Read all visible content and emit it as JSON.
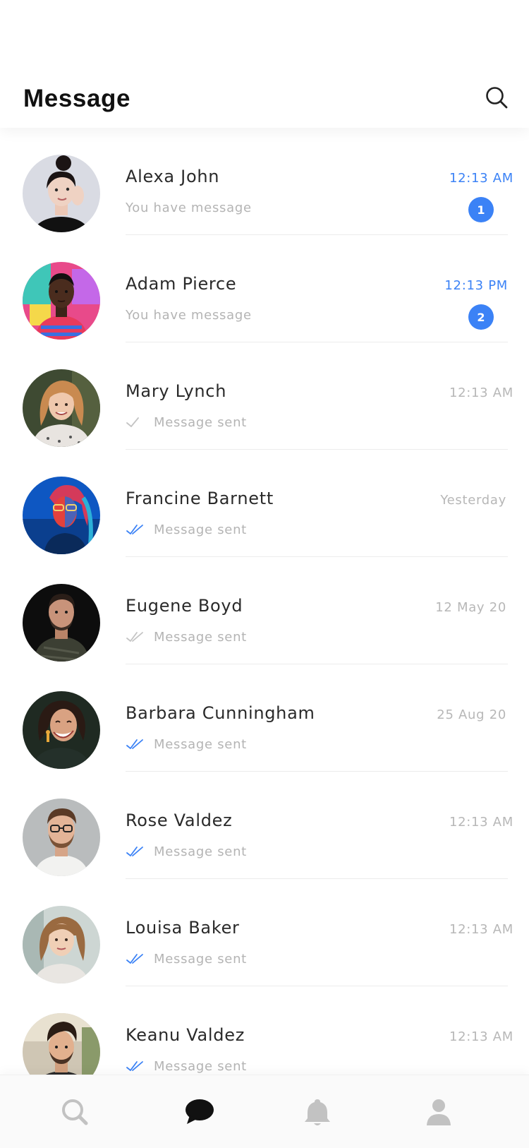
{
  "header": {
    "title": "Message",
    "search_icon": "search-icon"
  },
  "colors": {
    "accent": "#3b82f6",
    "muted_text": "#b4b4b4",
    "title_text": "#111111"
  },
  "conversations": [
    {
      "name": "Alexa John",
      "preview": "You have message",
      "time": "12:13 AM",
      "unread": true,
      "badge": "1",
      "status": "none",
      "avatar_icon": "avatar-photo"
    },
    {
      "name": "Adam Pierce",
      "preview": "You have message",
      "time": "12:13 PM",
      "unread": true,
      "badge": "2",
      "status": "none",
      "avatar_icon": "avatar-photo"
    },
    {
      "name": "Mary Lynch",
      "preview": "Message sent",
      "time": "12:13 AM",
      "unread": false,
      "badge": "",
      "status": "single-check-icon",
      "avatar_icon": "avatar-photo"
    },
    {
      "name": "Francine Barnett",
      "preview": "Message sent",
      "time": "Yesterday",
      "unread": false,
      "badge": "",
      "status": "double-check-read-icon",
      "avatar_icon": "avatar-photo"
    },
    {
      "name": "Eugene Boyd",
      "preview": "Message sent",
      "time": "12 May 20",
      "unread": false,
      "badge": "",
      "status": "double-check-icon",
      "avatar_icon": "avatar-photo"
    },
    {
      "name": "Barbara Cunningham",
      "preview": "Message sent",
      "time": "25 Aug 20",
      "unread": false,
      "badge": "",
      "status": "double-check-read-icon",
      "avatar_icon": "avatar-photo"
    },
    {
      "name": "Rose Valdez",
      "preview": "Message sent",
      "time": "12:13 AM",
      "unread": false,
      "badge": "",
      "status": "double-check-read-icon",
      "avatar_icon": "avatar-photo"
    },
    {
      "name": "Louisa Baker",
      "preview": "Message sent",
      "time": "12:13 AM",
      "unread": false,
      "badge": "",
      "status": "double-check-read-icon",
      "avatar_icon": "avatar-photo"
    },
    {
      "name": "Keanu Valdez",
      "preview": "Message sent",
      "time": "12:13 AM",
      "unread": false,
      "badge": "",
      "status": "double-check-read-icon",
      "avatar_icon": "avatar-photo"
    }
  ],
  "bottom_nav": {
    "items": [
      {
        "icon": "search-icon",
        "active": false
      },
      {
        "icon": "chat-bubble-icon",
        "active": true
      },
      {
        "icon": "bell-icon",
        "active": false
      },
      {
        "icon": "user-icon",
        "active": false
      }
    ]
  }
}
